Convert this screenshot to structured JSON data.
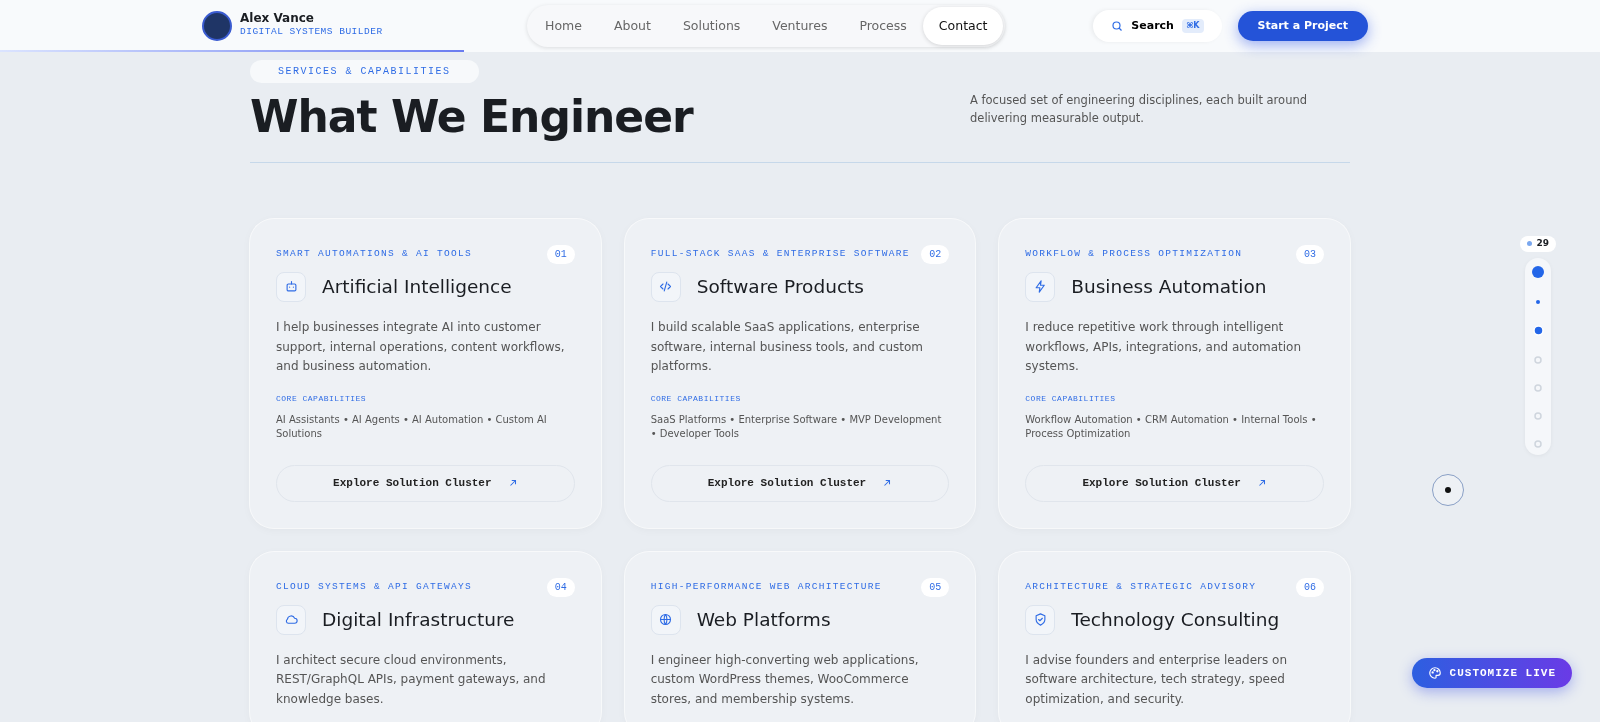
{
  "brand": {
    "name": "Alex Vance",
    "tagline": "DIGITAL SYSTEMS BUILDER"
  },
  "nav": [
    {
      "label": "Home",
      "selected": false
    },
    {
      "label": "About",
      "selected": false
    },
    {
      "label": "Solutions",
      "selected": false
    },
    {
      "label": "Ventures",
      "selected": false
    },
    {
      "label": "Process",
      "selected": false
    },
    {
      "label": "Contact",
      "selected": true
    }
  ],
  "search": {
    "label": "Search",
    "shortcut": "⌘K"
  },
  "cta": "Start a Project",
  "scroll_progress": {
    "level": 0.29
  },
  "section": {
    "eyebrow": "SERVICES & CAPABILITIES",
    "title": "What We Engineer",
    "intro": "A focused set of engineering disciplines, each built around delivering measurable output."
  },
  "cards": [
    {
      "eyebrow": "SMART AUTOMATIONS & AI TOOLS",
      "number": "01",
      "title": "Artificial Intelligence",
      "text": "I help businesses integrate AI into customer support, internal operations, content workflows, and business automation.",
      "caps_label": "CORE CAPABILITIES",
      "caps": "AI Assistants • AI Agents • AI Automation • Custom AI Solutions",
      "button": "Explore Solution Cluster"
    },
    {
      "eyebrow": "FULL-STACK SAAS & ENTERPRISE SOFTWARE",
      "number": "02",
      "title": "Software Products",
      "text": "I build scalable SaaS applications, enterprise software, internal business tools, and custom platforms.",
      "caps_label": "CORE CAPABILITIES",
      "caps": "SaaS Platforms • Enterprise Software • MVP Development • Developer Tools",
      "button": "Explore Solution Cluster"
    },
    {
      "eyebrow": "WORKFLOW & PROCESS OPTIMIZATION",
      "number": "03",
      "title": "Business Automation",
      "text": "I reduce repetitive work through intelligent workflows, APIs, integrations, and automation systems.",
      "caps_label": "CORE CAPABILITIES",
      "caps": "Workflow Automation • CRM Automation • Internal Tools • Process Optimization",
      "button": "Explore Solution Cluster"
    },
    {
      "eyebrow": "CLOUD SYSTEMS & API GATEWAYS",
      "number": "04",
      "title": "Digital Infrastructure",
      "text": "I architect secure cloud environments, REST/GraphQL APIs, payment gateways, and knowledge bases."
    },
    {
      "eyebrow": "HIGH-PERFORMANCE WEB ARCHITECTURE",
      "number": "05",
      "title": "Web Platforms",
      "text": "I engineer high-converting web applications, custom WordPress themes, WooCommerce stores, and membership systems."
    },
    {
      "eyebrow": "ARCHITECTURE & STRATEGIC ADVISORY",
      "number": "06",
      "title": "Technology Consulting",
      "text": "I advise founders and enterprise leaders on software architecture, tech strategy, speed optimization, and security."
    }
  ],
  "section_rail": {
    "counter": "29",
    "dots": [
      {
        "kind": "active"
      },
      {
        "kind": "minor"
      },
      {
        "kind": "filled"
      },
      {
        "kind": "empty"
      },
      {
        "kind": "empty"
      },
      {
        "kind": "empty"
      },
      {
        "kind": "empty"
      }
    ]
  },
  "customize": "CUSTOMIZE LIVE"
}
